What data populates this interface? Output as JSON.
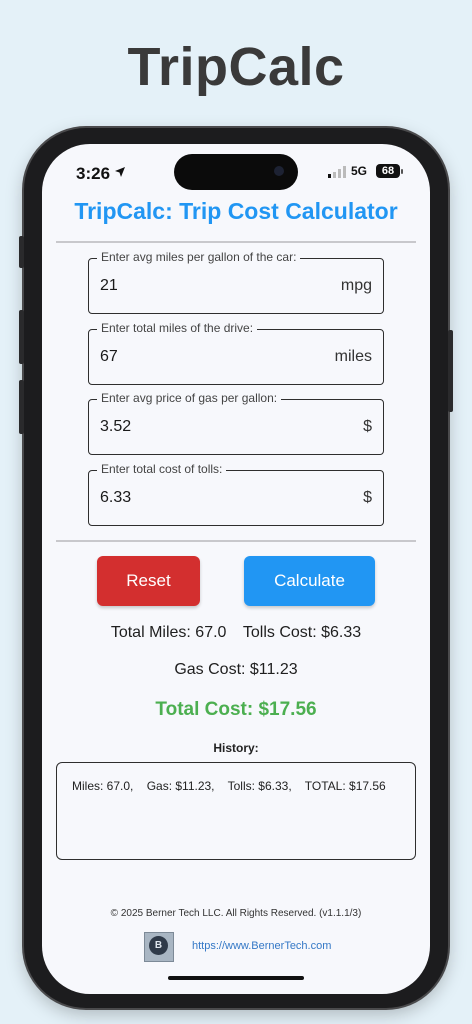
{
  "banner": {
    "title": "TripCalc"
  },
  "status": {
    "time": "3:26",
    "network": "5G",
    "battery": "68"
  },
  "header": {
    "title": "TripCalc: Trip Cost Calculator"
  },
  "fields": [
    {
      "label": "Enter avg miles per gallon of the car:",
      "value": "21",
      "suffix": "mpg"
    },
    {
      "label": "Enter total miles of the drive:",
      "value": "67",
      "suffix": "miles"
    },
    {
      "label": "Enter avg price of gas per gallon:",
      "value": "3.52",
      "suffix": "$"
    },
    {
      "label": "Enter total cost of tolls:",
      "value": "6.33",
      "suffix": "$"
    }
  ],
  "buttons": {
    "reset": "Reset",
    "calculate": "Calculate"
  },
  "results": {
    "total_miles": "Total Miles: 67.0",
    "tolls_cost": "Tolls Cost: $6.33",
    "gas_cost": "Gas Cost: $11.23",
    "total_cost": "Total Cost: $17.56"
  },
  "history": {
    "label": "History:",
    "entries": [
      "Miles: 67.0,    Gas: $11.23,    Tolls: $6.33,    TOTAL: $17.56"
    ]
  },
  "footer": {
    "copyright": "© 2025 Berner Tech LLC. All Rights Reserved.  (v1.1.1/3)",
    "website": "https://www.BernerTech.com"
  },
  "colors": {
    "title_blue": "#2196f3",
    "reset_red": "#d32f2f",
    "calculate_blue": "#2196f3",
    "total_green": "#4caf50"
  }
}
